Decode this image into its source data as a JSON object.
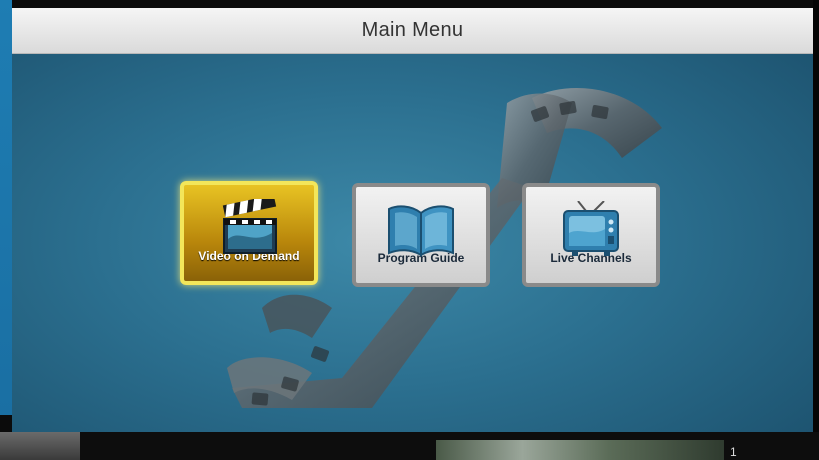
{
  "title": "Main Menu",
  "menu": {
    "items": [
      {
        "label": "Video on Demand",
        "icon": "clapperboard-icon",
        "selected": true
      },
      {
        "label": "Program Guide",
        "icon": "book-icon",
        "selected": false
      },
      {
        "label": "Live Channels",
        "icon": "tv-icon",
        "selected": false
      }
    ]
  },
  "colors": {
    "background_accent": "#2b6f8f",
    "selected_tile": "#e8c323",
    "selected_border": "#f3e65a",
    "tile_border": "#8a8a8a",
    "titlebar": "#f0f0f0"
  },
  "overlay": {
    "thumbnail_mark": "1"
  }
}
